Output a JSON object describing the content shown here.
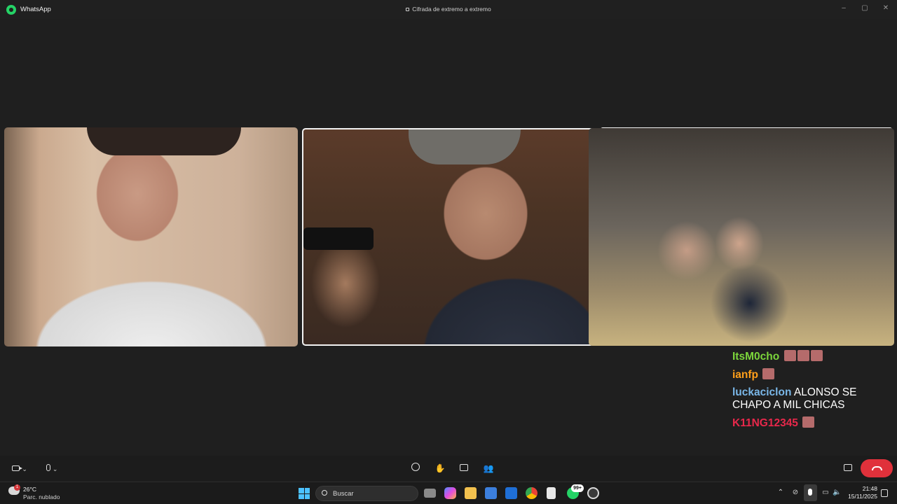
{
  "titlebar": {
    "app_name": "WhatsApp",
    "encryption_note": "Cifrada de extremo a extremo",
    "minimize": "–",
    "maximize": "▢",
    "close": "✕"
  },
  "chat": {
    "messages": [
      {
        "user": "ItsM0cho",
        "user_color": "#7cd63b",
        "text": "",
        "emotes": 3
      },
      {
        "user": "ianfp",
        "user_color": "#ff9f1a",
        "text": "",
        "emotes": 1
      },
      {
        "user": "luckaciclon",
        "user_color": "#7ab7e8",
        "text": "ALONSO SE CHAPO A MIL CHICAS",
        "emotes": 0
      },
      {
        "user": "K11NG12345",
        "user_color": "#e8284b",
        "text": "",
        "emotes": 1
      }
    ]
  },
  "callbar": {
    "controls": [
      "camera",
      "microphone",
      "emoji-reactions",
      "raise-hand",
      "share-screen",
      "add-participants",
      "layout",
      "end-call"
    ],
    "end_call_color": "#e0313b"
  },
  "taskbar": {
    "temperature": "26°C",
    "weather": "Parc. nublado",
    "weather_badge": "1",
    "search_label": "Buscar",
    "whatsapp_badge": "99+",
    "time": "21:48",
    "date": "15/11/2025"
  }
}
